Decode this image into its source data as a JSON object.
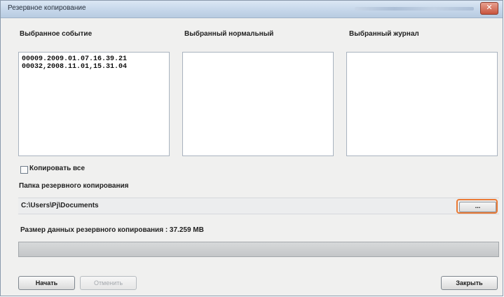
{
  "window": {
    "title": "Резервное копирование",
    "close_label": "✕"
  },
  "columns": {
    "events": {
      "label": "Выбранное событие",
      "items": [
        "00009.2009.01.07.16.39.21",
        "00032,2008.11.01,15.31.04"
      ]
    },
    "normal": {
      "label": "Выбранный нормальный",
      "items": []
    },
    "journal": {
      "label": "Выбранный журнал",
      "items": []
    }
  },
  "copy_all": {
    "label": "Копировать все",
    "checked": false
  },
  "backup_folder": {
    "label": "Папка резервного копирования",
    "path": "C:\\Users\\Pj\\Documents",
    "browse_label": "..."
  },
  "data_size": {
    "label": "Размер данных резервного копирования : 37.259 MB"
  },
  "progress": {
    "value": 0
  },
  "buttons": {
    "start": "Начать",
    "cancel": "Отменить",
    "close": "Закрыть"
  },
  "colors": {
    "highlight": "#ea7a35",
    "window_bg": "#f0f0ef"
  }
}
